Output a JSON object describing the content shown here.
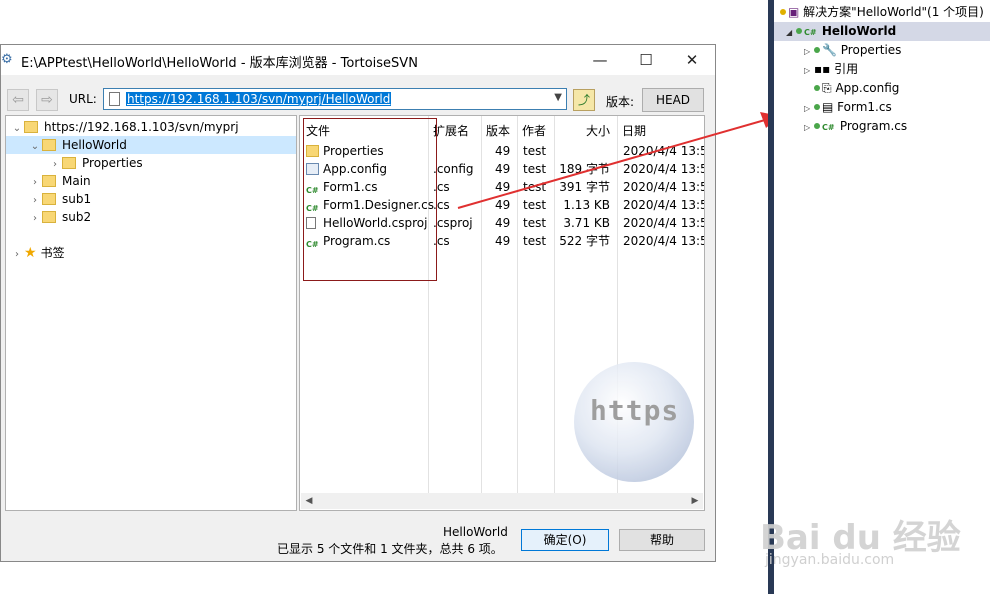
{
  "window": {
    "title": "E:\\APPtest\\HelloWorld\\HelloWorld - 版本库浏览器 - TortoiseSVN",
    "minimize_glyph": "—",
    "maximize_glyph": "☐",
    "close_glyph": "✕"
  },
  "toolbar": {
    "back_glyph": "⇦",
    "forward_glyph": "⇨",
    "url_label": "URL:",
    "url_value": "https://192.168.1.103/svn/myprj/HelloWorld",
    "revision_label": "版本:",
    "head_button": "HEAD"
  },
  "tree": {
    "root": "https://192.168.1.103/svn/myprj",
    "items": [
      {
        "label": "HelloWorld"
      },
      {
        "label": "Properties"
      },
      {
        "label": "Main"
      },
      {
        "label": "sub1"
      },
      {
        "label": "sub2"
      }
    ],
    "bookmarks": "书签"
  },
  "list": {
    "columns": [
      "文件",
      "扩展名",
      "版本",
      "作者",
      "大小",
      "日期"
    ],
    "rows": [
      {
        "name": "Properties",
        "ext": "",
        "rev": "49",
        "author": "test",
        "size": "",
        "date": "2020/4/4 13:5",
        "icon": "folder-icon"
      },
      {
        "name": "App.config",
        "ext": ".config",
        "rev": "49",
        "author": "test",
        "size": "189 字节",
        "date": "2020/4/4 13:5",
        "icon": "config-file-icon"
      },
      {
        "name": "Form1.cs",
        "ext": ".cs",
        "rev": "49",
        "author": "test",
        "size": "391 字节",
        "date": "2020/4/4 13:5",
        "icon": "csharp-file-icon"
      },
      {
        "name": "Form1.Designer.cs",
        "ext": ".cs",
        "rev": "49",
        "author": "test",
        "size": "1.13 KB",
        "date": "2020/4/4 13:5",
        "icon": "csharp-file-icon"
      },
      {
        "name": "HelloWorld.csproj",
        "ext": ".csproj",
        "rev": "49",
        "author": "test",
        "size": "3.71 KB",
        "date": "2020/4/4 13:5",
        "icon": "project-file-icon"
      },
      {
        "name": "Program.cs",
        "ext": ".cs",
        "rev": "49",
        "author": "test",
        "size": "522 字节",
        "date": "2020/4/4 13:5",
        "icon": "csharp-file-icon"
      }
    ],
    "watermark": "https"
  },
  "status": {
    "line1": "HelloWorld",
    "line2": "已显示 5 个文件和 1 文件夹，总共 6 项。",
    "ok_button": "确定(O)",
    "help_button": "帮助"
  },
  "solution_explorer": {
    "solution": "解决方案\"HelloWorld\"(1 个项目)",
    "project": "HelloWorld",
    "items": [
      "Properties",
      "引用",
      "App.config",
      "Form1.cs",
      "Program.cs"
    ],
    "csharp_badge": "C#"
  },
  "watermark": {
    "brand": "Bai du 经验",
    "site": "jingyan.baidu.com"
  },
  "colors": {
    "selection": "#0078d7",
    "annotation_arrow": "#e03030",
    "sidebar_divider": "#293955"
  }
}
